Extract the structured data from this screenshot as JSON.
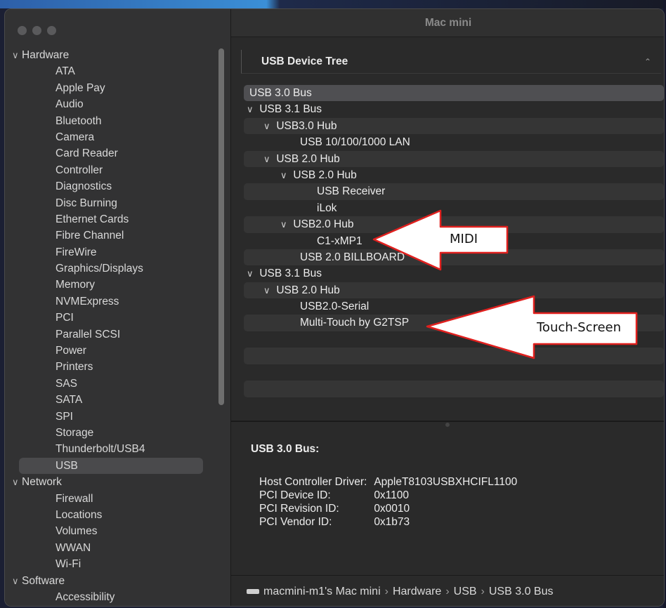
{
  "window": {
    "title": "Mac mini"
  },
  "sidebar": {
    "groups": [
      {
        "label": "Hardware",
        "items": [
          "ATA",
          "Apple Pay",
          "Audio",
          "Bluetooth",
          "Camera",
          "Card Reader",
          "Controller",
          "Diagnostics",
          "Disc Burning",
          "Ethernet Cards",
          "Fibre Channel",
          "FireWire",
          "Graphics/Displays",
          "Memory",
          "NVMExpress",
          "PCI",
          "Parallel SCSI",
          "Power",
          "Printers",
          "SAS",
          "SATA",
          "SPI",
          "Storage",
          "Thunderbolt/USB4",
          "USB"
        ]
      },
      {
        "label": "Network",
        "items": [
          "Firewall",
          "Locations",
          "Volumes",
          "WWAN",
          "Wi-Fi"
        ]
      },
      {
        "label": "Software",
        "items": [
          "Accessibility"
        ]
      }
    ],
    "selected": "USB"
  },
  "tree": {
    "header": "USB Device Tree",
    "rows": [
      {
        "label": "USB 3.0 Bus",
        "chevron": false
      },
      {
        "label": "USB 3.1 Bus",
        "chevron": true
      },
      {
        "label": "USB3.0 Hub",
        "chevron": true
      },
      {
        "label": "USB 10/100/1000 LAN",
        "chevron": false
      },
      {
        "label": "USB 2.0 Hub",
        "chevron": true
      },
      {
        "label": "USB 2.0 Hub",
        "chevron": true
      },
      {
        "label": "USB Receiver",
        "chevron": false
      },
      {
        "label": "iLok",
        "chevron": false
      },
      {
        "label": "USB2.0 Hub",
        "chevron": true
      },
      {
        "label": "C1-xMP1",
        "chevron": false
      },
      {
        "label": "USB 2.0 BILLBOARD",
        "chevron": false
      },
      {
        "label": "USB 3.1 Bus",
        "chevron": true
      },
      {
        "label": "USB 2.0 Hub",
        "chevron": true
      },
      {
        "label": "USB2.0-Serial",
        "chevron": false
      },
      {
        "label": "Multi-Touch by G2TSP",
        "chevron": false
      }
    ],
    "selected": "USB 3.0 Bus"
  },
  "details": {
    "heading": "USB 3.0 Bus:",
    "fields": [
      {
        "key": "Host Controller Driver:",
        "value": "AppleT8103USBXHCIFL1100"
      },
      {
        "key": "PCI Device ID:",
        "value": "0x1100"
      },
      {
        "key": "PCI Revision ID:",
        "value": "0x0010"
      },
      {
        "key": "PCI Vendor ID:",
        "value": "0x1b73"
      }
    ]
  },
  "pathbar": {
    "segments": [
      "macmini-m1's Mac mini",
      "Hardware",
      "USB",
      "USB 3.0 Bus"
    ]
  },
  "annotations": {
    "midi": "MIDI",
    "touch": "Touch-Screen"
  }
}
